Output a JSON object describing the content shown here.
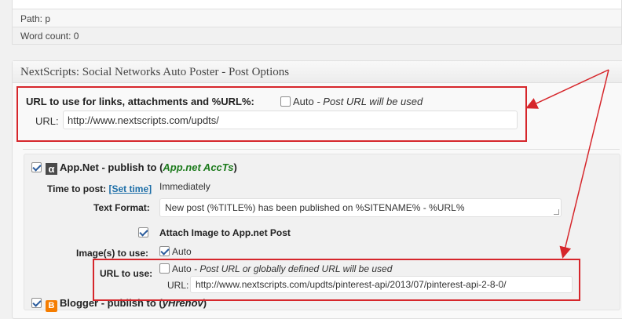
{
  "editor_status": {
    "path": "Path: p",
    "word_count": "Word count: 0"
  },
  "postbox": {
    "title": "NextScripts: Social Networks Auto Poster - Post Options"
  },
  "url_section": {
    "title": "URL to use for links, attachments and %URL%:",
    "auto_label": "Auto",
    "auto_note": " - Post URL will be used",
    "auto_checked": false,
    "url_label": "URL:",
    "url_value": "http://www.nextscripts.com/updts/"
  },
  "appnet": {
    "checked": true,
    "icon": "alpha-icon",
    "icon_glyph": "α",
    "name": "App.Net - publish to (",
    "accts": "App.net AccTs",
    "close": ")",
    "time_label": "Time to post:",
    "set_time": "[Set time]",
    "time_value": "Immediately",
    "text_format_label": "Text Format:",
    "text_format_value": "New post (%TITLE%) has been published on %SITENAME% - %URL%",
    "attach_label": "Attach Image to App.net Post",
    "attach_checked": true,
    "images_label": "Image(s) to use:",
    "images_auto": "Auto",
    "images_auto_checked": true,
    "url_to_use_label": "URL to use:",
    "url_auto": "Auto",
    "url_auto_note": " - Post URL or globally defined URL will be used",
    "url_auto_checked": false,
    "url_label": "URL:",
    "url_value": "http://www.nextscripts.com/updts/pinterest-api/2013/07/pinterest-api-2-8-0/"
  },
  "blogger": {
    "checked": true,
    "icon": "blogger-icon",
    "icon_glyph": "B",
    "name": "Blogger - publish to (",
    "accts": "yHrenov",
    "close": ")"
  },
  "annotation_color": "#d6262b"
}
